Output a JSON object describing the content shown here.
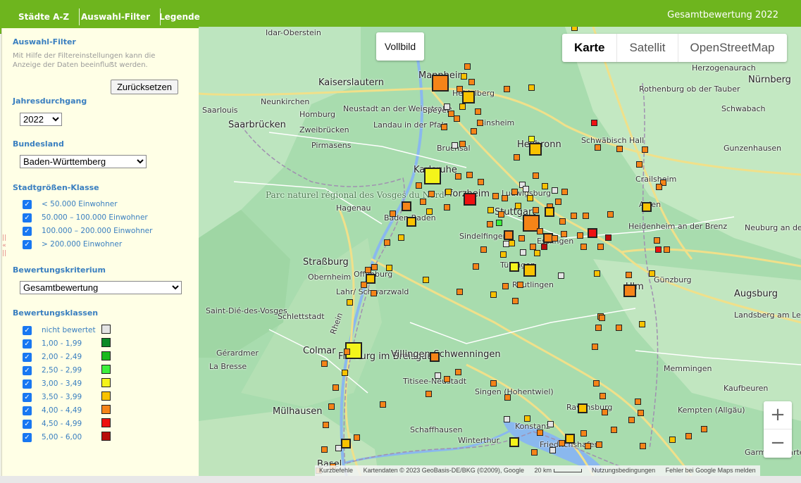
{
  "nav": {
    "items": [
      "Städte A-Z",
      "Auswahl-Filter",
      "Legende"
    ],
    "title": "Gesamtbewertung 2022",
    "bar_color": "#6eb51e"
  },
  "sidebar": {
    "heading": "Auswahl-Filter",
    "description": "Mit Hilfe der Filtereinstellungen kann die Anzeige der Daten beeinfluẞt werden.",
    "reset_label": "Zurücksetzen",
    "year": {
      "label": "Jahresdurchgang",
      "value": "2022"
    },
    "state": {
      "label": "Bundesland",
      "value": "Baden-Württemberg"
    },
    "size_class": {
      "label": "Stadtgrößen-Klasse",
      "options": [
        "< 50.000 Einwohner",
        "50.000 – 100.000 Einwohner",
        "100.000 – 200.000 Einwohner",
        "> 200.000 Einwohner"
      ]
    },
    "criterion": {
      "label": "Bewertungskriterium",
      "value": "Gesamtbewertung"
    },
    "classes": {
      "label": "Bewertungsklassen",
      "items": [
        {
          "label": "nicht bewertet",
          "color": "#e4e4e4"
        },
        {
          "label": "1,00 - 1,99",
          "color": "#0b8a28"
        },
        {
          "label": "2,00 - 2,49",
          "color": "#18b91c"
        },
        {
          "label": "2,50 - 2,99",
          "color": "#3cf03c"
        },
        {
          "label": "3,00 - 3,49",
          "color": "#f4f41a"
        },
        {
          "label": "3,50 - 3,99",
          "color": "#f9c200"
        },
        {
          "label": "4,00 - 4,49",
          "color": "#f58418"
        },
        {
          "label": "4,50 - 4,99",
          "color": "#ee1111"
        },
        {
          "label": "5,00 - 6,00",
          "color": "#b80c0c"
        }
      ]
    }
  },
  "map": {
    "fullscreen_label": "Vollbild",
    "map_types": [
      "Karte",
      "Satellit",
      "OpenStreetMap"
    ],
    "active_map_type": "Karte",
    "zoom_in": "+",
    "zoom_out": "−",
    "places": [
      "Idar-Oberstein",
      "Mannheim",
      "Kaiserslautern",
      "Heidelberg",
      "Neunkirchen",
      "Homburg",
      "Neustadt an der Weinstraße",
      "Saarlouis",
      "Saarbrücken",
      "Zweibrücken",
      "Landau in der Pfalz",
      "Speyer",
      "Sinsheim",
      "Pirmasens",
      "Bruchsal",
      "Heilbronn",
      "Schwäbisch Hall",
      "Karlsruhe",
      "Pforzheim",
      "Ludwigsburg",
      "Stuttgart",
      "Esslingen",
      "Hagenau",
      "Baden-Baden",
      "Sindelfingen",
      "Aalen",
      "Heidenheim an der Brenz",
      "Crailsheim",
      "Rothenburg ob der Tauber",
      "Schwabach",
      "Nürnberg",
      "Herzogenaurach",
      "Gunzenhausen",
      "Straßburg",
      "Offenburg",
      "Obernheim",
      "Tübingen",
      "Reutlingen",
      "Ulm",
      "Günzburg",
      "Neuburg an der Donau",
      "Augsburg",
      "Lahr/ Schwarzwald",
      "Saint-Dié-des-Vosges",
      "Schlettstadt",
      "Colmar",
      "Gérardmer",
      "La Bresse",
      "Freiburg im Breisgau",
      "Villingen-Schwenningen",
      "Titisee-Neustadt",
      "Singen (Hohentwiel)",
      "Konstanz",
      "Ravensburg",
      "Friedrichshafen",
      "Mülhausen",
      "Schaffhausen",
      "Winterthur",
      "Basel",
      "Landsberg am Lech",
      "Memmingen",
      "Kaufbeuren",
      "Kempten (Allgäu)",
      "Garmisch-Partenkirchen",
      "Parc naturel régional des Vosges du Nord",
      "Rhein"
    ],
    "attribution": [
      "Kurzbefehle",
      "Kartendaten © 2023 GeoBasis-DE/BKG (©2009), Google",
      "20 km",
      "Nutzungsbedingungen",
      "Fehler bei Google Maps melden"
    ]
  }
}
